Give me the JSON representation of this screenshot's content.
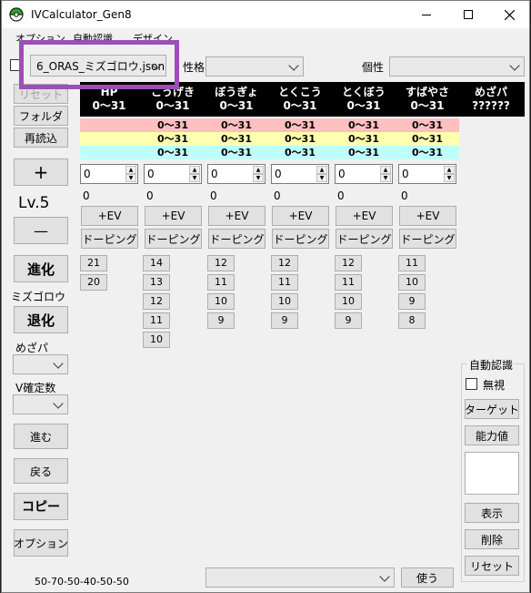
{
  "window": {
    "title": "IVCalculator_Gen8"
  },
  "menu": [
    "オプション",
    "自動認識",
    "デザイン"
  ],
  "top_bar": {
    "file_select": "6_ORAS_ミズゴロウ.json",
    "nature_label": "性格",
    "nature_value": "",
    "characteristic_label": "個性",
    "characteristic_value": ""
  },
  "left": {
    "reset": "リセット",
    "folder": "フォルダ",
    "reload": "再読込",
    "plus": "+",
    "level": "Lv.5",
    "minus": "—",
    "evolve": "進化",
    "pokemon_name": "ミズゴロウ",
    "devolve": "退化",
    "hidden_power_label": "めざパ",
    "v_count_label": "V確定数",
    "next": "進む",
    "back": "戻る",
    "copy": "コピー",
    "options": "オプション",
    "base_stats": "50-70-50-40-50-50"
  },
  "stats": {
    "headers": [
      {
        "name": "HP",
        "range": "0〜31"
      },
      {
        "name": "こうげき",
        "range": "0〜31"
      },
      {
        "name": "ぼうぎょ",
        "range": "0〜31"
      },
      {
        "name": "とくこう",
        "range": "0〜31"
      },
      {
        "name": "とくぼう",
        "range": "0〜31"
      },
      {
        "name": "すばやさ",
        "range": "0〜31"
      }
    ],
    "hidden_power": {
      "name": "めざパ",
      "value": "??????"
    },
    "band_pink": [
      "",
      "0〜31",
      "0〜31",
      "0〜31",
      "0〜31",
      "0〜31"
    ],
    "band_yellow": [
      "",
      "0〜31",
      "0〜31",
      "0〜31",
      "0〜31",
      "0〜31"
    ],
    "band_cyan": [
      "",
      "0〜31",
      "0〜31",
      "0〜31",
      "0〜31",
      "0〜31"
    ],
    "inputs": [
      "0",
      "0",
      "0",
      "0",
      "0",
      "0"
    ],
    "evs": [
      "0",
      "0",
      "0",
      "0",
      "0",
      "0"
    ],
    "ev_button": "+EV",
    "doping_button": "ドーピング",
    "candidates": [
      [
        "21",
        "20"
      ],
      [
        "14",
        "13",
        "12",
        "11",
        "10"
      ],
      [
        "12",
        "11",
        "10",
        "9"
      ],
      [
        "12",
        "11",
        "10",
        "9"
      ],
      [
        "12",
        "11",
        "10",
        "9"
      ],
      [
        "11",
        "10",
        "9",
        "8"
      ]
    ]
  },
  "auto_recognition": {
    "title": "自動認識",
    "ignore_label": "無視",
    "target": "ターゲット",
    "stats_button": "能力値",
    "show": "表示",
    "delete": "削除",
    "reset": "リセット"
  },
  "bottom": {
    "select_value": "",
    "use": "使う"
  }
}
